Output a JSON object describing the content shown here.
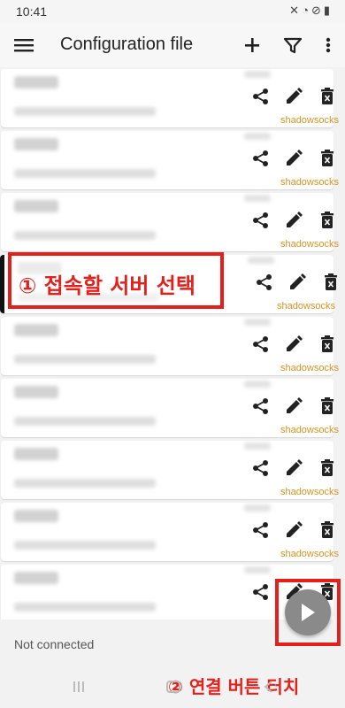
{
  "status_bar": {
    "time": "10:41",
    "icons": [
      "mute-icon",
      "wifi-icon",
      "dnd-icon",
      "battery-icon"
    ]
  },
  "app_bar": {
    "title": "Configuration file",
    "actions": [
      "add-icon",
      "filter-icon",
      "more-vert-icon"
    ]
  },
  "servers": [
    {
      "protocol": "shadowsocks",
      "selected": false
    },
    {
      "protocol": "shadowsocks",
      "selected": false
    },
    {
      "protocol": "shadowsocks",
      "selected": false
    },
    {
      "protocol": "shadowsocks",
      "selected": true
    },
    {
      "protocol": "shadowsocks",
      "selected": false
    },
    {
      "protocol": "shadowsocks",
      "selected": false
    },
    {
      "protocol": "shadowsocks",
      "selected": false
    },
    {
      "protocol": "shadowsocks",
      "selected": false
    },
    {
      "protocol": "",
      "selected": false
    }
  ],
  "annotations": {
    "step1": "① 접속할 서버 선택",
    "step2": "② 연결 버튼 터치"
  },
  "footer": {
    "status": "Not connected"
  },
  "colors": {
    "protocol": "#d89320",
    "annotation": "#e3201b",
    "fab": "#8a8a8a"
  }
}
